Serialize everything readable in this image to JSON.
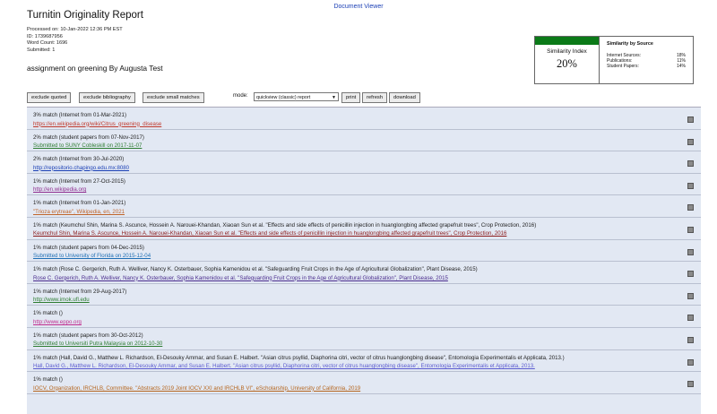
{
  "header": {
    "viewer_link": "Document Viewer",
    "title": "Turnitin Originality Report",
    "processed": "Processed on: 10-Jan-2022 12:36 PM EST",
    "id": "ID: 1739687956",
    "word_count": "Word Count: 1696",
    "submitted": "Submitted: 1",
    "assignment": "assignment on greening By Augusta Test"
  },
  "similarity": {
    "index_label": "Similarity Index",
    "index_value": "20%",
    "by_source_title": "Similarity by Source",
    "sources": [
      {
        "label": "Internet Sources:",
        "value": "18%"
      },
      {
        "label": "Publications:",
        "value": "11%"
      },
      {
        "label": "Student Papers:",
        "value": "14%"
      }
    ],
    "bar_color": "#0b7a18"
  },
  "toolbar": {
    "exclude_quoted": "exclude quoted",
    "exclude_bibliography": "exclude bibliography",
    "exclude_small_matches": "exclude small matches",
    "mode_label": "mode:",
    "mode_value": "quickview (classic) report",
    "print": "print",
    "refresh": "refresh",
    "download": "download"
  },
  "matches": [
    {
      "line1": "3% match (Internet from 01-Mar-2021)",
      "link": "https://en.wikipedia.org/wiki/Citrus_greening_disease",
      "color": "#c0392b"
    },
    {
      "line1": "2% match (student papers from 07-Nov-2017)",
      "link": "Submitted to SUNY Cobleskill on 2017-11-07",
      "color": "#2e7d32"
    },
    {
      "line1": "2% match (Internet from 30-Jul-2020)",
      "link": "http://repositorio.chapingo.edu.mx:8080",
      "color": "#1a3fb5"
    },
    {
      "line1": "1% match (Internet from 27-Oct-2015)",
      "link": "http://en.wikipedia.org",
      "color": "#8e2c8e"
    },
    {
      "line1": "1% match (Internet from 01-Jan-2021)",
      "link": "\"Trioza erytreae\", Wikipedia, en, 2021",
      "color": "#c0652b"
    },
    {
      "line1": "1% match (Keumchul Shin, Marina S. Ascunce, Hossein A. Narouei-Khandan, Xiaoan Sun et al. \"Effects and side effects of penicillin injection in huanglongbing affected grapefruit trees\", Crop Protection, 2016)",
      "link": "Keumchul Shin, Marina S. Ascunce, Hossein A. Narouei-Khandan, Xiaoan Sun et al. \"Effects and side effects of penicillin injection in huanglongbing affected grapefruit trees\", Crop Protection, 2016",
      "color": "#8b1a1a"
    },
    {
      "line1": "1% match (student papers from 04-Dec-2015)",
      "link": "Submitted to University of Florida on 2015-12-04",
      "color": "#1f6fb5"
    },
    {
      "line1": "1% match (Rose C. Gergerich, Ruth A. Welliver, Nancy K. Osterbauer, Sophia Kamenidou et al. \"Safeguarding Fruit Crops in the Age of Agricultural Globalization\", Plant Disease, 2015)",
      "link": "Rose C. Gergerich, Ruth A. Welliver, Nancy K. Osterbauer, Sophia Kamenidou et al. \"Safeguarding Fruit Crops in the Age of Agricultural Globalization\", Plant Disease, 2015",
      "color": "#4a2c8e"
    },
    {
      "line1": "1% match (Internet from 29-Aug-2017)",
      "link": "http://www.imok.ufl.edu",
      "color": "#2e7d32"
    },
    {
      "line1": "1% match ()",
      "link": "http://www.eppo.org",
      "color": "#c02b8e"
    },
    {
      "line1": "1% match (student papers from 30-Oct-2012)",
      "link": "Submitted to Universiti Putra Malaysia on 2012-10-30",
      "color": "#2e7d32"
    },
    {
      "line1": "1% match (Hall, David G., Matthew L. Richardson, El-Desouky Ammar, and Susan E. Halbert. \"Asian citrus psyllid, Diaphorina citri, vector of citrus huanglongbing disease\", Entomologia Experimentalis et Applicata, 2013.)",
      "link": "Hall, David G., Matthew L. Richardson, El-Desouky Ammar, and Susan E. Halbert. \"Asian citrus psyllid, Diaphorina citri, vector of citrus huanglongbing disease\", Entomologia Experimentalis et Applicata, 2013.",
      "color": "#5b5bd0"
    },
    {
      "line1": "1% match ()",
      "link": "IOCV, Organization, IRCHLB, Committee. \"Abstracts 2019 Joint IOCV XXI and IRCHLB VI\", eScholarship, University of California, 2019",
      "color": "#b5651d"
    }
  ]
}
